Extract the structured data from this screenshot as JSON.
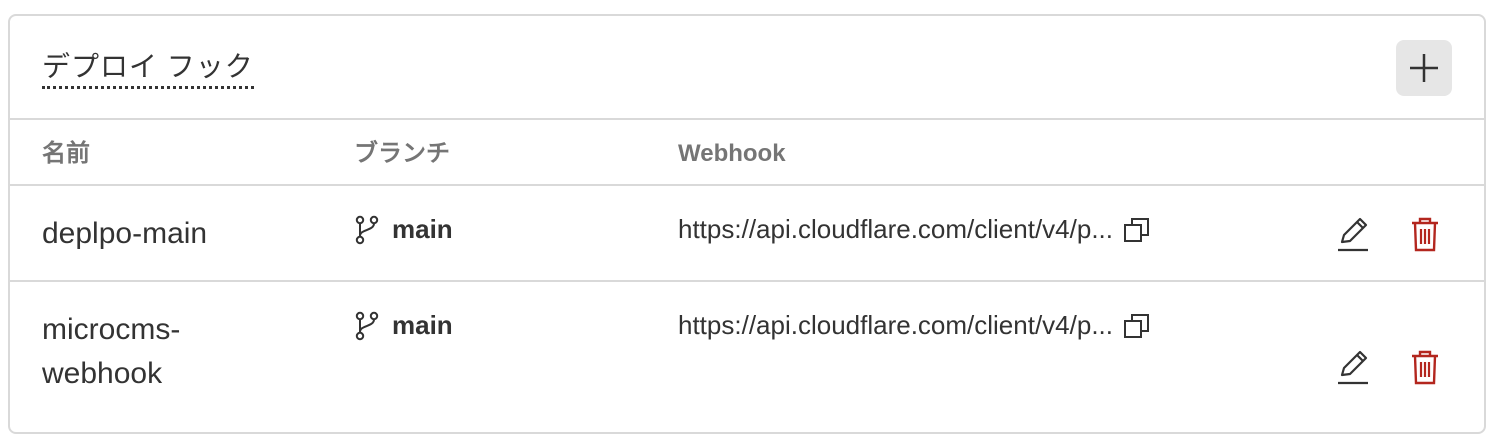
{
  "header": {
    "title": "デプロイ フック",
    "add_icon": "plus-icon"
  },
  "table": {
    "columns": [
      "名前",
      "ブランチ",
      "Webhook"
    ],
    "rows": [
      {
        "name": "deplpo-main",
        "branch": "main",
        "webhook": "https://api.cloudflare.com/client/v4/p..."
      },
      {
        "name": "microcms-webhook",
        "branch": "main",
        "webhook": "https://api.cloudflare.com/client/v4/p..."
      }
    ]
  },
  "icons": {
    "branch": "git-branch-icon",
    "copy": "copy-icon",
    "edit": "pencil-icon",
    "delete": "trash-icon"
  },
  "colors": {
    "border": "#d9d9d9",
    "header_text": "#757575",
    "delete": "#b3261e",
    "add_button_bg": "#e6e6e6"
  }
}
